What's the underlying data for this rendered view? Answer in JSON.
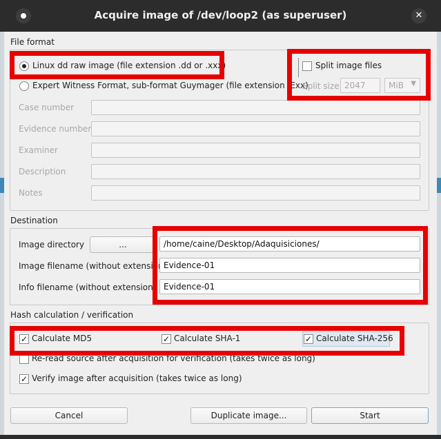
{
  "window": {
    "title": "Acquire image of /dev/loop2 (as superuser)"
  },
  "file_format": {
    "group_title": "File format",
    "radio_dd": "Linux dd raw image (file extension .dd or .xxx)",
    "radio_ewf": "Expert Witness Format, sub-format Guymager (file extension .Exx)",
    "split_label": "Split image files",
    "split_size_label": "Split size",
    "split_size_value": "2047",
    "split_unit": "MiB",
    "fields": {
      "case_number": "Case number",
      "evidence_number": "Evidence number",
      "examiner": "Examiner",
      "description": "Description",
      "notes": "Notes"
    }
  },
  "destination": {
    "group_title": "Destination",
    "image_directory_label": "Image directory",
    "browse_label": "...",
    "image_directory_value": "/home/caine/Desktop/Adaquisiciones/",
    "image_filename_label": "Image filename (without extension)",
    "image_filename_value": "Evidence-01",
    "info_filename_label": "Info filename (without extension)",
    "info_filename_value": "Evidence-01"
  },
  "hash": {
    "group_title": "Hash calculation / verification",
    "md5": "Calculate MD5",
    "sha1": "Calculate SHA-1",
    "sha256": "Calculate SHA-256",
    "reread": "Re-read source after acquisition for verification (takes twice as long)",
    "verify": "Verify image after acquisition (takes twice as long)",
    "check_mark": "✓"
  },
  "buttons": {
    "cancel": "Cancel",
    "duplicate": "Duplicate image...",
    "start": "Start"
  },
  "titlebar_close": "✕",
  "colors": {
    "highlight": "#e60000",
    "accent": "#3e88b8"
  }
}
